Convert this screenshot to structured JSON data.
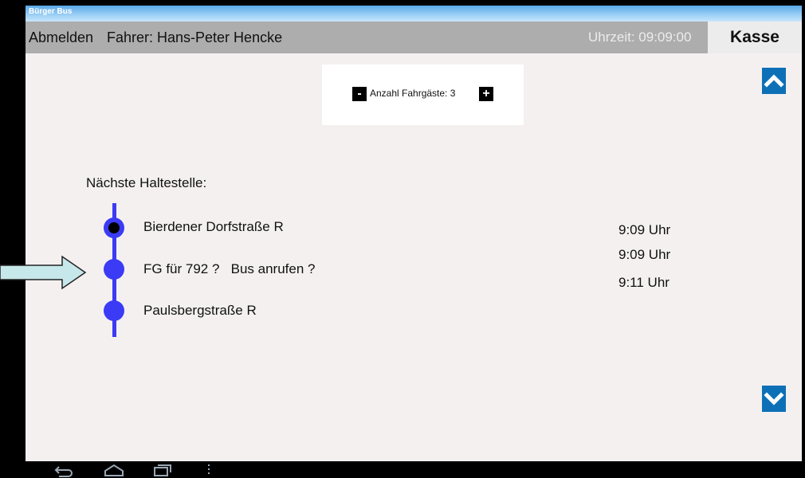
{
  "window": {
    "title": "Bürger Bus"
  },
  "header": {
    "logout_label": "Abmelden",
    "driver_label": "Fahrer: Hans-Peter Hencke",
    "time_label": "Uhrzeit: 09:09:00",
    "cash_label": "Kasse"
  },
  "passengers": {
    "minus_label": "-",
    "label": "Anzahl Fahrgäste: 3",
    "plus_label": "+"
  },
  "route": {
    "title": "Nächste Haltestelle:",
    "stops": [
      {
        "name": "Bierdener Dorfstraße R",
        "time": "9:09 Uhr"
      },
      {
        "name": "FG für 792 ?   Bus anrufen ?",
        "time": "9:09 Uhr"
      },
      {
        "name": "Paulsbergstraße R",
        "time": "9:11 Uhr"
      }
    ]
  },
  "scroll": {
    "up_icon": "chevron-up-icon",
    "down_icon": "chevron-down-icon"
  },
  "system_nav": {
    "icons": [
      "back-icon",
      "home-icon",
      "recent-apps-icon",
      "menu-dots-icon"
    ]
  },
  "colors": {
    "route_blue": "#3b3bf5",
    "scroll_button": "#0d70b7",
    "header_gray": "#adadad"
  }
}
